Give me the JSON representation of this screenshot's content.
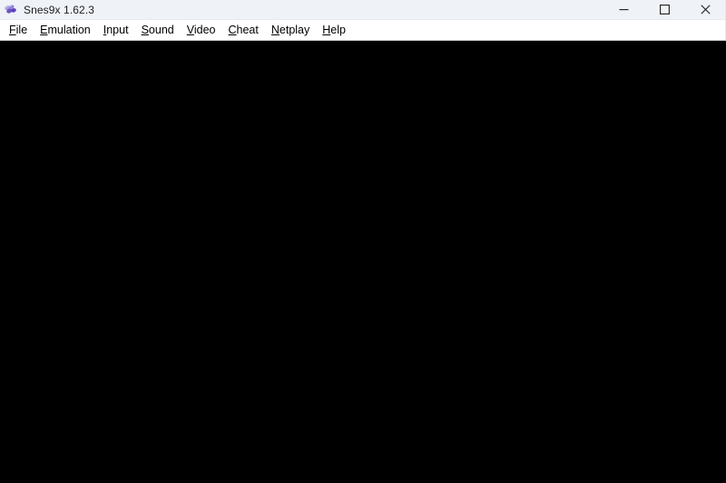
{
  "window": {
    "title": "Snes9x 1.62.3",
    "app_icon_name": "snes9x-logo-icon",
    "icon_colors": {
      "light_purple": "#a99fe0",
      "mid_purple": "#8a7ad4",
      "dark_purple": "#6b4fc4",
      "deep_purple": "#5a3fb0"
    },
    "titlebar_bg": "#eff2f6",
    "menubar_bg": "#ffffff",
    "viewport_bg": "#000000"
  },
  "window_controls": {
    "minimize_label": "Minimize",
    "maximize_label": "Maximize",
    "close_label": "Close"
  },
  "menu": {
    "items": [
      {
        "label": "File",
        "mnemonic": "F",
        "rest": "ile"
      },
      {
        "label": "Emulation",
        "mnemonic": "E",
        "rest": "mulation"
      },
      {
        "label": "Input",
        "mnemonic": "I",
        "rest": "nput"
      },
      {
        "label": "Sound",
        "mnemonic": "S",
        "rest": "ound"
      },
      {
        "label": "Video",
        "mnemonic": "V",
        "rest": "ideo"
      },
      {
        "label": "Cheat",
        "mnemonic": "C",
        "rest": "heat"
      },
      {
        "label": "Netplay",
        "mnemonic": "N",
        "rest": "etplay"
      },
      {
        "label": "Help",
        "mnemonic": "H",
        "rest": "elp"
      }
    ]
  },
  "viewport": {
    "content": ""
  }
}
